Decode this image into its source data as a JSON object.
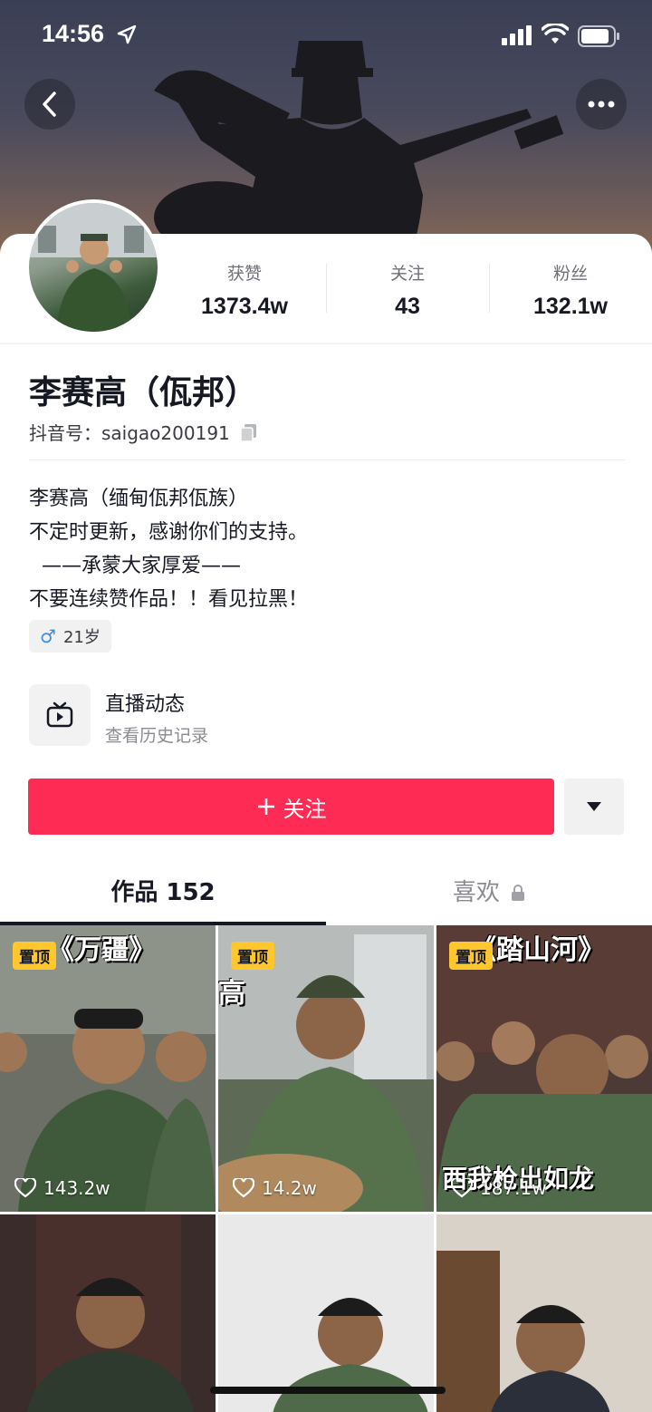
{
  "status_bar": {
    "time": "14:56"
  },
  "profile": {
    "name": "李赛高（佤邦）",
    "douyin_id": "抖音号：saigao200191",
    "stats": [
      {
        "label": "获赞",
        "value": "1373.4w"
      },
      {
        "label": "关注",
        "value": "43"
      },
      {
        "label": "粉丝",
        "value": "132.1w"
      }
    ],
    "bio": "李赛高（缅甸佤邦佤族）\n不定时更新，感谢你们的支持。\n  ——承蒙大家厚爱——\n不要连续赞作品！！看见拉黑！",
    "tag": {
      "gender_icon": "male-icon",
      "age": "21岁"
    }
  },
  "live": {
    "title": "直播动态",
    "subtitle": "查看历史记录"
  },
  "actions": {
    "follow_label": "关注"
  },
  "tabs": [
    {
      "label": "作品 152",
      "active": true
    },
    {
      "label": "喜欢",
      "locked": true
    }
  ],
  "videos": [
    {
      "pinned": true,
      "pin_label": "置顶",
      "likes": "143.2w",
      "caption": "《万疆》"
    },
    {
      "pinned": true,
      "pin_label": "置顶",
      "likes": "14.2w",
      "caption": "高"
    },
    {
      "pinned": true,
      "pin_label": "置顶",
      "likes": "187.1w",
      "caption": "《踏山河》",
      "caption2": "西我枪出如龙"
    },
    {
      "pinned": false
    },
    {
      "pinned": false
    },
    {
      "pinned": false
    }
  ],
  "colors": {
    "accent": "#fe2c55",
    "pin": "#fdc72d",
    "male": "#3a8de8"
  }
}
